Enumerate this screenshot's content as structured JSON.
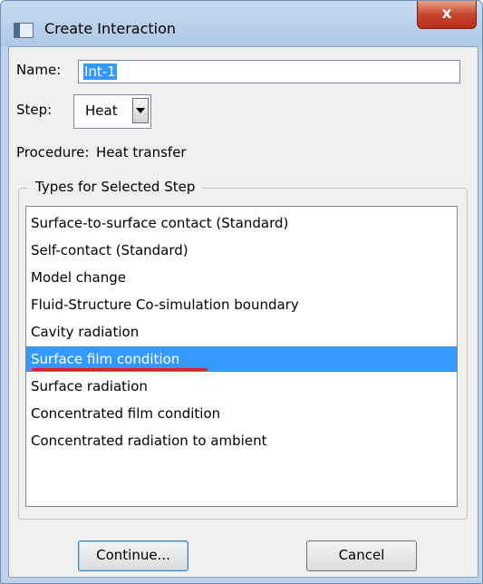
{
  "window": {
    "title": "Create Interaction",
    "close_label": "x"
  },
  "form": {
    "name_label": "Name:",
    "name_value": "Int-1",
    "step_label": "Step:",
    "step_value": "Heat",
    "procedure_label": "Procedure:",
    "procedure_value": "Heat transfer"
  },
  "types_group": {
    "title": "Types for Selected Step",
    "items": [
      {
        "label": "Surface-to-surface contact (Standard)",
        "selected": false
      },
      {
        "label": "Self-contact (Standard)",
        "selected": false
      },
      {
        "label": "Model change",
        "selected": false
      },
      {
        "label": "Fluid-Structure Co-simulation boundary",
        "selected": false
      },
      {
        "label": "Cavity radiation",
        "selected": false
      },
      {
        "label": "Surface film condition",
        "selected": true
      },
      {
        "label": "Surface radiation",
        "selected": false
      },
      {
        "label": "Concentrated film condition",
        "selected": false
      },
      {
        "label": "Concentrated radiation to ambient",
        "selected": false
      }
    ]
  },
  "buttons": {
    "continue_label": "Continue...",
    "cancel_label": "Cancel"
  },
  "colors": {
    "selection": "#3399ff",
    "annotation_underline": "#e02020",
    "close_button": "#c9452c"
  }
}
